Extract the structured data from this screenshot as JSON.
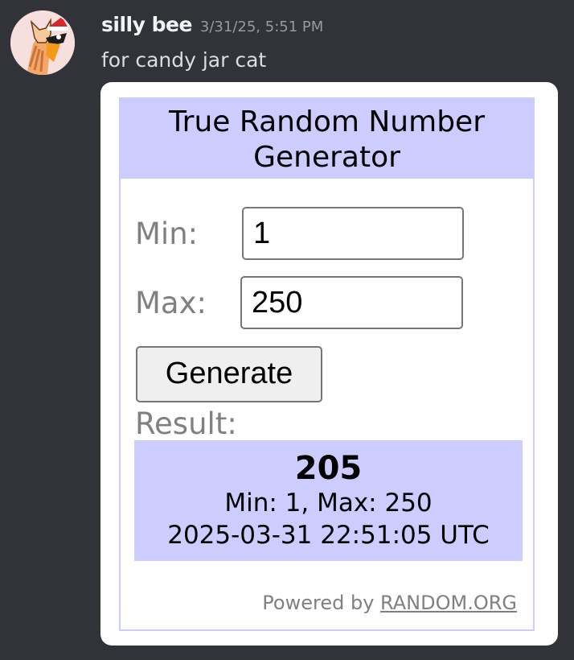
{
  "message": {
    "username": "silly bee",
    "timestamp": "3/31/25, 5:51 PM",
    "text": "for candy jar cat"
  },
  "widget": {
    "title": "True Random Number Generator",
    "min_label": "Min:",
    "min_value": "1",
    "max_label": "Max:",
    "max_value": "250",
    "generate_label": "Generate",
    "result_label": "Result:",
    "result": {
      "number": "205",
      "range": "Min: 1, Max: 250",
      "time": "2025-03-31 22:51:05 UTC"
    },
    "powered_prefix": "Powered by",
    "powered_link": "RANDOM.ORG"
  },
  "colors": {
    "background": "#313338",
    "widget_accent": "#ccccff",
    "label_gray": "#808080"
  },
  "icons": {
    "avatar": "cartoon-cat-avatar"
  }
}
